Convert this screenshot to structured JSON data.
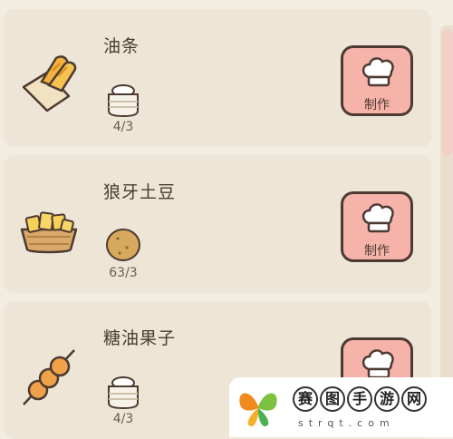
{
  "recipes": [
    {
      "name": "油条",
      "food_icon": "youtiao-icon",
      "ingredient_icon": "flour-bag-icon",
      "count": "4/3",
      "button_label": "制作"
    },
    {
      "name": "狼牙土豆",
      "food_icon": "potato-fries-icon",
      "ingredient_icon": "potato-icon",
      "count": "63/3",
      "button_label": "制作"
    },
    {
      "name": "糖油果子",
      "food_icon": "fried-dough-skewer-icon",
      "ingredient_icon": "flour-bag-icon",
      "count": "4/3",
      "button_label": "制作"
    }
  ],
  "watermark": {
    "chars": [
      "赛",
      "图",
      "手",
      "游",
      "网"
    ],
    "url": "strqt.com"
  },
  "colors": {
    "background": "#f3ece1",
    "card": "#ede5d6",
    "button": "#f6b3aa",
    "button_border": "#4d3a32",
    "text": "#4a3c31"
  }
}
